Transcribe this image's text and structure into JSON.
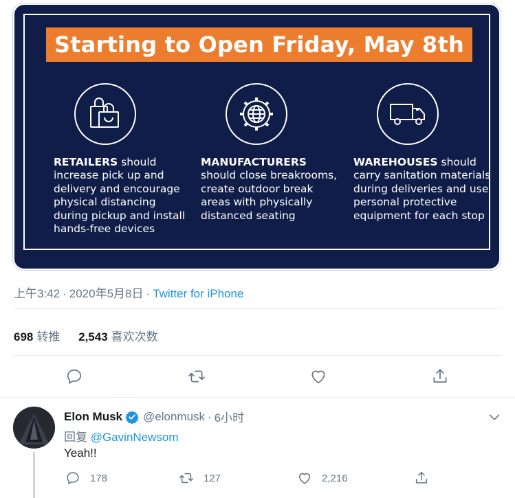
{
  "poster": {
    "banner": "Starting to Open Friday, May 8th",
    "columns": [
      {
        "icon": "shopping-bag-icon",
        "heading": "RETAILERS",
        "text": " should increase pick up and delivery and encourage physical distancing during pickup and install hands-free devices"
      },
      {
        "icon": "gear-globe-icon",
        "heading": "MANUFACTURERS",
        "text": " should close breakrooms, create outdoor break areas with physically distanced seating"
      },
      {
        "icon": "delivery-truck-icon",
        "heading": "WAREHOUSES",
        "text": " should carry sanitation materials during deliveries and use personal protective equipment for each stop"
      }
    ],
    "colors": {
      "background": "#101d48",
      "banner": "#ec7d2f"
    }
  },
  "tweet": {
    "time": "上午3:42",
    "separator": "·",
    "date": "2020年5月8日",
    "source": "Twitter for iPhone",
    "retweets": "698",
    "retweets_label": "转推",
    "likes": "2,543",
    "likes_label": "喜欢次数"
  },
  "actions": {
    "reply": "reply-icon",
    "retweet": "retweet-icon",
    "like": "heart-icon",
    "share": "share-icon"
  },
  "reply": {
    "name": "Elon Musk",
    "handle": "@elonmusk",
    "separator": "·",
    "time": "6小时",
    "reply_prefix": "回复",
    "reply_mention": "@GavinNewsom",
    "text": "Yeah!!",
    "reply_count": "178",
    "retweet_count": "127",
    "like_count": "2,216"
  },
  "accent": "#1b95e0",
  "muted": "#657786"
}
